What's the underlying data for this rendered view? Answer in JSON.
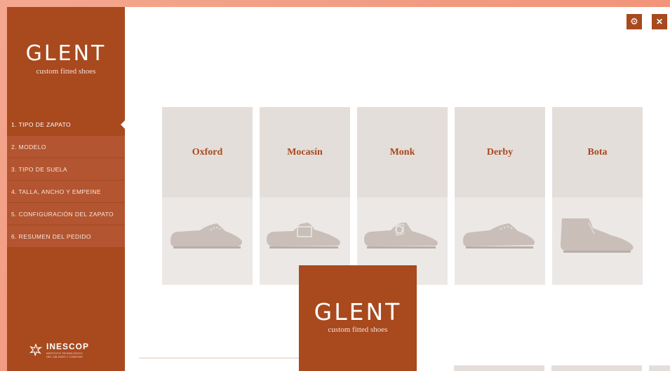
{
  "app": {
    "logo_word": "GLENT",
    "logo_tagline": "custom fitted shoes"
  },
  "toolbar": {
    "settings_icon": "gear-icon",
    "close_icon": "close-icon",
    "close_glyph": "✕",
    "settings_glyph": "⚙"
  },
  "sidebar": {
    "items": [
      {
        "label": "1. TIPO DE ZAPATO",
        "active": true
      },
      {
        "label": "2. MODELO",
        "active": false
      },
      {
        "label": "3. TIPO DE SUELA",
        "active": false
      },
      {
        "label": "4. TALLA, ANCHO Y EMPEINE",
        "active": false
      },
      {
        "label": "5. CONFIGURACIÓN DEL ZAPATO",
        "active": false
      },
      {
        "label": "6. RESUMEN DEL PEDIDO",
        "active": false
      }
    ],
    "partner": {
      "name": "INESCOP",
      "subtitle_1": "INSTITUTO TECNOLÓGICO",
      "subtitle_2": "DEL CALZADO Y CONEXAS"
    }
  },
  "shoe_types": [
    {
      "name": "Oxford",
      "icon": "oxford-shoe-icon"
    },
    {
      "name": "Mocasín",
      "icon": "loafer-shoe-icon"
    },
    {
      "name": "Monk",
      "icon": "monk-shoe-icon"
    },
    {
      "name": "Derby",
      "icon": "derby-shoe-icon"
    },
    {
      "name": "Bota",
      "icon": "boot-icon"
    }
  ],
  "splash": {
    "logo_word": "GLENT",
    "logo_tagline": "custom fitted shoes"
  },
  "colors": {
    "brand": "#a8491e",
    "card_top": "#e4deda",
    "card_bottom": "#ece8e6",
    "shoe": "#c9bfb8"
  }
}
